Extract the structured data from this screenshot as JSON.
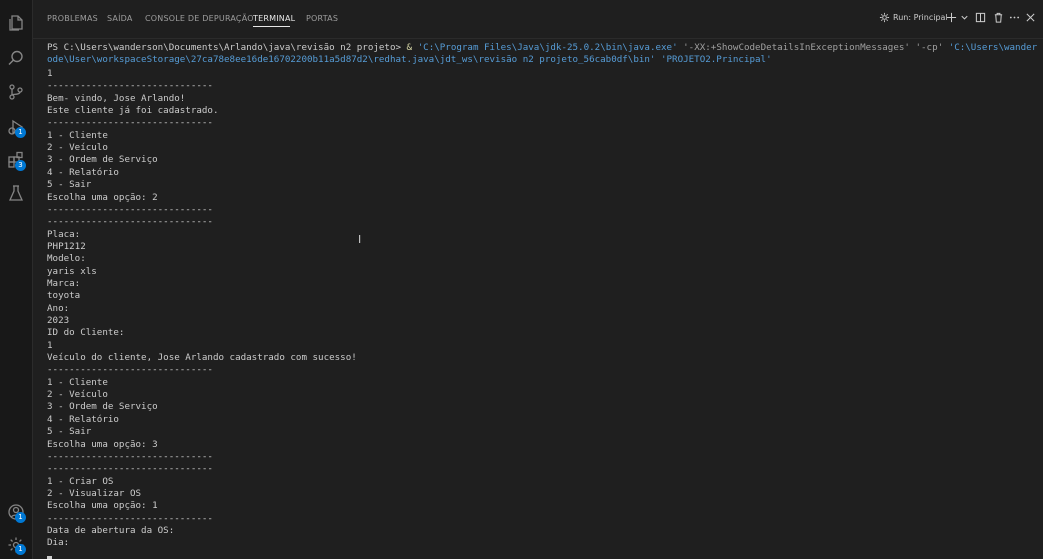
{
  "activity_bar": {
    "extensions_badge": "3",
    "accounts_badge": "1",
    "settings_badge": "1"
  },
  "panel": {
    "tabs": [
      {
        "label": "PROBLEMAS",
        "active": false
      },
      {
        "label": "SAÍDA",
        "active": false
      },
      {
        "label": "CONSOLE DE DEPURAÇÃO",
        "active": false
      },
      {
        "label": "TERMINAL",
        "active": true
      },
      {
        "label": "PORTAS",
        "active": false
      }
    ],
    "run_label": "Run: Principal"
  },
  "terminal": {
    "prompt": "PS C:\\Users\\wanderson\\Documents\\Arlando\\java\\revisão n2 projeto> ",
    "command_amp": "& ",
    "command_exe": "'C:\\Program Files\\Java\\jdk-25.0.2\\bin\\java.exe'",
    "command_flag1": " '-XX:+ShowCodeDetailsInExceptionMessages'",
    "command_flag2": " '-cp'",
    "command_path_start": " 'C:\\Users\\wanderson\\AppData\\Roami",
    "command_continuation": "ode\\User\\workspaceStorage\\27ca78e8ee16de16702200b11a5d87d2\\redhat.java\\jdt_ws\\revisão n2 projeto_56cab0df\\bin'",
    "command_main": " 'PROJETO2.Principal'",
    "lines": [
      "1",
      "------------------------------",
      "Bem- vindo, Jose Arlando!",
      "Este cliente já foi cadastrado.",
      "------------------------------",
      "1 - Cliente",
      "2 - Veículo",
      "3 - Ordem de Serviço",
      "4 - Relatório",
      "5 - Sair",
      "Escolha uma opção: 2",
      "------------------------------",
      "------------------------------",
      "Placa:",
      "PHP1212",
      "Modelo:",
      "yaris xls",
      "Marca:",
      "toyota",
      "Ano:",
      "2023",
      "ID do Cliente:",
      "1",
      "Veículo do cliente, Jose Arlando cadastrado com sucesso!",
      "------------------------------",
      "1 - Cliente",
      "2 - Veículo",
      "3 - Ordem de Serviço",
      "4 - Relatório",
      "5 - Sair",
      "Escolha uma opção: 3",
      "------------------------------",
      "------------------------------",
      "1 - Criar OS",
      "2 - Visualizar OS",
      "Escolha uma opção: 1",
      "------------------------------",
      "Data de abertura da OS:",
      "Dia:"
    ]
  }
}
